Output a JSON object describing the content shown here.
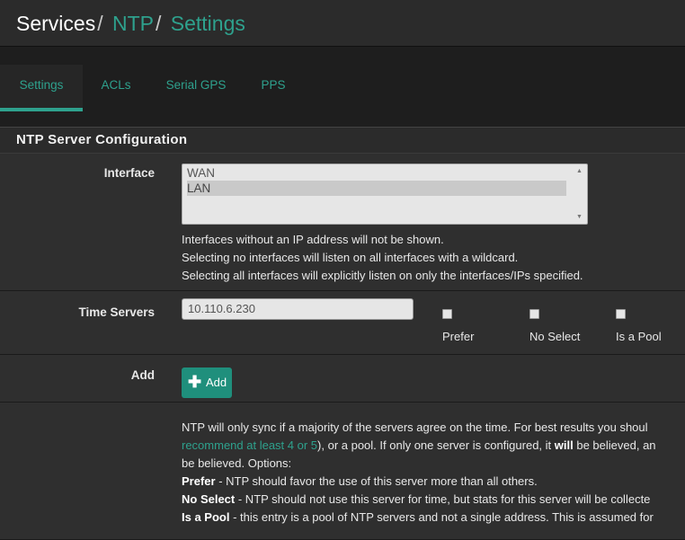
{
  "breadcrumb": {
    "root": "Services",
    "sep1": "/",
    "ntp": "NTP",
    "sep2": "/",
    "settings": "Settings"
  },
  "tabs": [
    {
      "label": "Settings",
      "active": true
    },
    {
      "label": "ACLs",
      "active": false
    },
    {
      "label": "Serial GPS",
      "active": false
    },
    {
      "label": "PPS",
      "active": false
    }
  ],
  "panel": {
    "title": "NTP Server Configuration"
  },
  "interface": {
    "label": "Interface",
    "options": [
      "WAN",
      "LAN"
    ],
    "selected": "LAN",
    "help": [
      "Interfaces without an IP address will not be shown.",
      "Selecting no interfaces will listen on all interfaces with a wildcard.",
      "Selecting all interfaces will explicitly listen on only the interfaces/IPs specified."
    ]
  },
  "time_servers": {
    "label": "Time Servers",
    "value": "10.110.6.230",
    "prefer_label": "Prefer",
    "noselect_label": "No Select",
    "pool_label": "Is a Pool"
  },
  "add": {
    "label": "Add",
    "button_label": "Add"
  },
  "info": {
    "line1": "NTP will only sync if a majority of the servers agree on the time. For best results you shoul",
    "line2_link": "recommend at least 4 or 5",
    "line2_a": "), or a pool. If only one server is configured, it ",
    "line2_bold": "will",
    "line2_b": " be believed, an",
    "line3": "be believed. Options:",
    "prefer_bold": "Prefer",
    "prefer_text": " - NTP should favor the use of this server more than all others.",
    "noselect_bold": "No Select",
    "noselect_text": " - NTP should not use this server for time, but stats for this server will be collecte",
    "pool_bold": "Is a Pool",
    "pool_text": " - this entry is a pool of NTP servers and not a single address. This is assumed for"
  },
  "colors": {
    "accent": "#2ea18d",
    "button": "#1f8f7c",
    "background": "#1e1e1e",
    "panel": "#2f2f2f"
  }
}
